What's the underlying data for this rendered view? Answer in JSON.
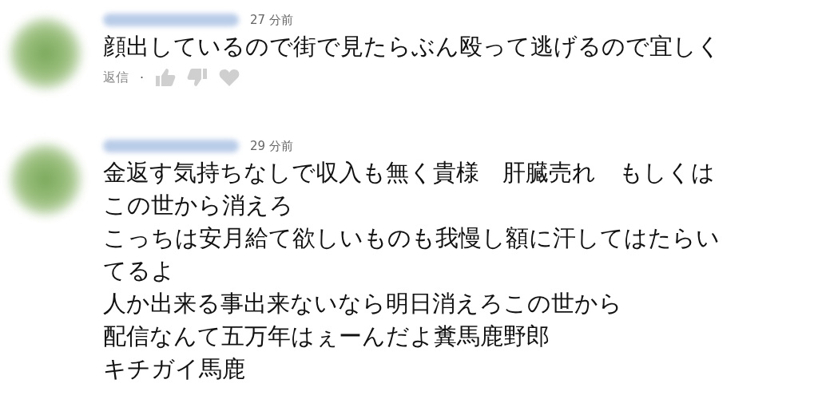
{
  "comments": [
    {
      "time": "27 分前",
      "lines": [
        "顔出しているので街で見たらぶん殴って逃げるので宜しく"
      ],
      "reply": "返信",
      "separator": "·"
    },
    {
      "time": "29 分前",
      "lines": [
        "金返す気持ちなしで収入も無く貴様　肝臓売れ　もしくは",
        "この世から消えろ",
        "こっちは安月給て欲しいものも我慢し額に汗してはたらい",
        "てるよ",
        "人か出来る事出来ないなら明日消えろこの世から",
        "配信なんて五万年はぇーんだよ糞馬鹿野郎",
        "キチガイ馬鹿"
      ]
    }
  ]
}
